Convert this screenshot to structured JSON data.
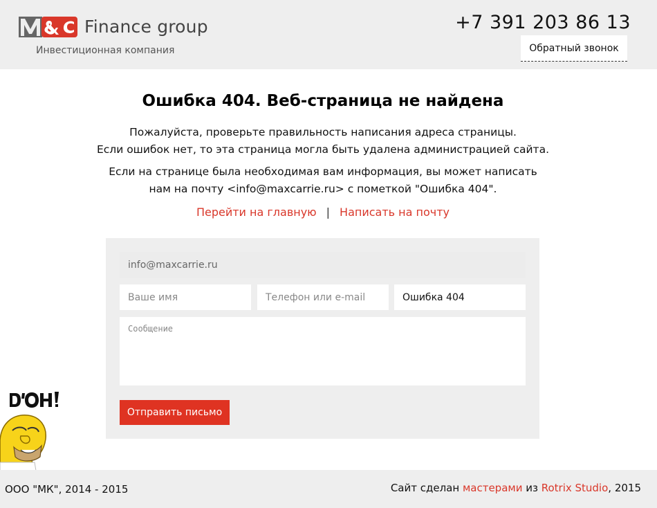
{
  "header": {
    "logo_text": "Finance group",
    "logo_subtitle": "Инвестиционная компания",
    "phone": "+7 391 203 86 13",
    "callback_label": "Обратный звонок"
  },
  "error": {
    "title": "Ошибка 404. Веб-страница не найдена",
    "line1": "Пожалуйста, проверьте правильность написания адреса страницы.",
    "line2": "Если ошибок нет, то эта страница могла быть удалена администрацией сайта.",
    "line3": "Если на странице была необходимая вам информация, вы может написать",
    "line4": "нам на почту <info@maxcarrie.ru> с пометкой \"Ошибка 404\"."
  },
  "links": {
    "home": "Перейти на главную",
    "separator": "|",
    "mail": "Написать на почту"
  },
  "form": {
    "email_value": "info@maxcarrie.ru",
    "name_placeholder": "Ваше имя",
    "contact_placeholder": "Телефон или e-mail",
    "subject_value": "Ошибка 404",
    "message_placeholder": "Сообщение",
    "send_label": "Отправить письмо"
  },
  "footer": {
    "copyright": "ООО \"МК\", 2014 - 2015",
    "made_prefix": "Сайт сделан ",
    "made_link": "мастерами",
    "made_middle": " из ",
    "studio_link": "Rotrix Studio",
    "made_suffix": ", 2015"
  },
  "colors": {
    "accent": "#df3322",
    "link": "#d9372a",
    "panel": "#eeeeee"
  },
  "icons": {
    "logo": "mc-logo-mark",
    "doh": "homer-doh-image"
  }
}
